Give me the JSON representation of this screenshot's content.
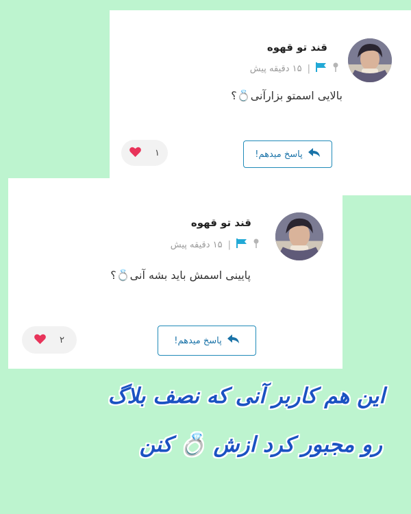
{
  "card1": {
    "username": "قند تو قهوه",
    "time": "۱۵ دقیقه پیش",
    "separator": "|",
    "comment": "بالایی اسمتو بزارآنی💍؟",
    "reply_label": "پاسخ میدهم!",
    "like_count": "۱"
  },
  "card2": {
    "username": "قند تو قهوه",
    "time": "۱۵ دقیقه پیش",
    "separator": "|",
    "comment": "پایینی اسمش باید بشه آنی💍؟",
    "reply_label": "پاسخ میدهم!",
    "like_count": "۲"
  },
  "caption": {
    "line1": "این هم کاربر آنی که نصف بلاگ",
    "line2": "رو مجبور کرد ازش 💍 کنن"
  },
  "icons": {
    "pin": "pin-icon",
    "flag": "flag-icon",
    "reply": "reply-arrow-icon",
    "heart": "heart-icon"
  },
  "colors": {
    "background": "#bdf4cf",
    "accent": "#1f8ab8",
    "flag": "#22a9d6",
    "heart": "#e8345a",
    "caption": "#1b52c2"
  }
}
